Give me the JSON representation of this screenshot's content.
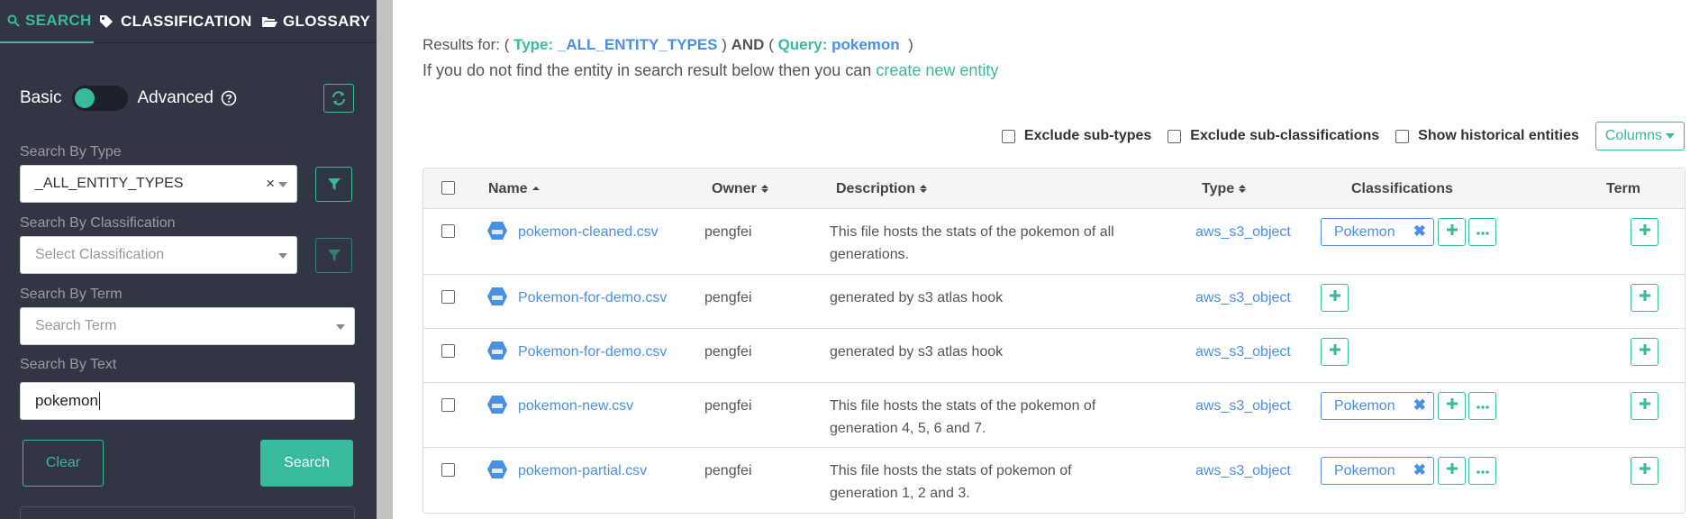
{
  "tabs": [
    {
      "label": "SEARCH",
      "icon": "search-icon"
    },
    {
      "label": "CLASSIFICATION",
      "icon": "tags-icon"
    },
    {
      "label": "GLOSSARY",
      "icon": "folder-open-icon"
    }
  ],
  "mode": {
    "basic_label": "Basic",
    "advanced_label": "Advanced",
    "advanced_on": false
  },
  "filters": {
    "type_label": "Search By Type",
    "type_value": "_ALL_ENTITY_TYPES",
    "classification_label": "Search By Classification",
    "classification_placeholder": "Select Classification",
    "term_label": "Search By Term",
    "term_placeholder": "Search Term",
    "text_label": "Search By Text",
    "text_value": "pokemon",
    "clear_label": "Clear",
    "search_label": "Search"
  },
  "results": {
    "prefix": "Results for:",
    "type_label": "Type:",
    "type_value": "_ALL_ENTITY_TYPES",
    "and": "AND",
    "query_label": "Query:",
    "query_value": "pokemon",
    "hint": "If you do not find the entity in search result below then you can",
    "create_link": "create new entity"
  },
  "options": {
    "exclude_subtypes": "Exclude sub-types",
    "exclude_subclassifications": "Exclude sub-classifications",
    "show_historical": "Show historical entities",
    "columns_label": "Columns"
  },
  "table": {
    "headers": {
      "name": "Name",
      "owner": "Owner",
      "description": "Description",
      "type": "Type",
      "classifications": "Classifications",
      "term": "Term"
    },
    "rows": [
      {
        "name": "pokemon-cleaned.csv",
        "owner": "pengfei",
        "description": "This file hosts the stats of the pokemon of all generations.",
        "type": "aws_s3_object",
        "classification": "Pokemon"
      },
      {
        "name": "Pokemon-for-demo.csv",
        "owner": "pengfei",
        "description": "generated by s3 atlas hook",
        "type": "aws_s3_object",
        "classification": ""
      },
      {
        "name": "Pokemon-for-demo.csv",
        "owner": "pengfei",
        "description": "generated by s3 atlas hook",
        "type": "aws_s3_object",
        "classification": ""
      },
      {
        "name": "pokemon-new.csv",
        "owner": "pengfei",
        "description": "This file hosts the stats of the pokemon of generation 4, 5, 6 and 7.",
        "type": "aws_s3_object",
        "classification": "Pokemon"
      },
      {
        "name": "pokemon-partial.csv",
        "owner": "pengfei",
        "description": "This file hosts the stats of pokemon of generation 1, 2 and 3.",
        "type": "aws_s3_object",
        "classification": "Pokemon"
      }
    ]
  },
  "colors": {
    "accent": "#37bb9b",
    "link": "#4a90e2",
    "sidebar": "#323544"
  }
}
